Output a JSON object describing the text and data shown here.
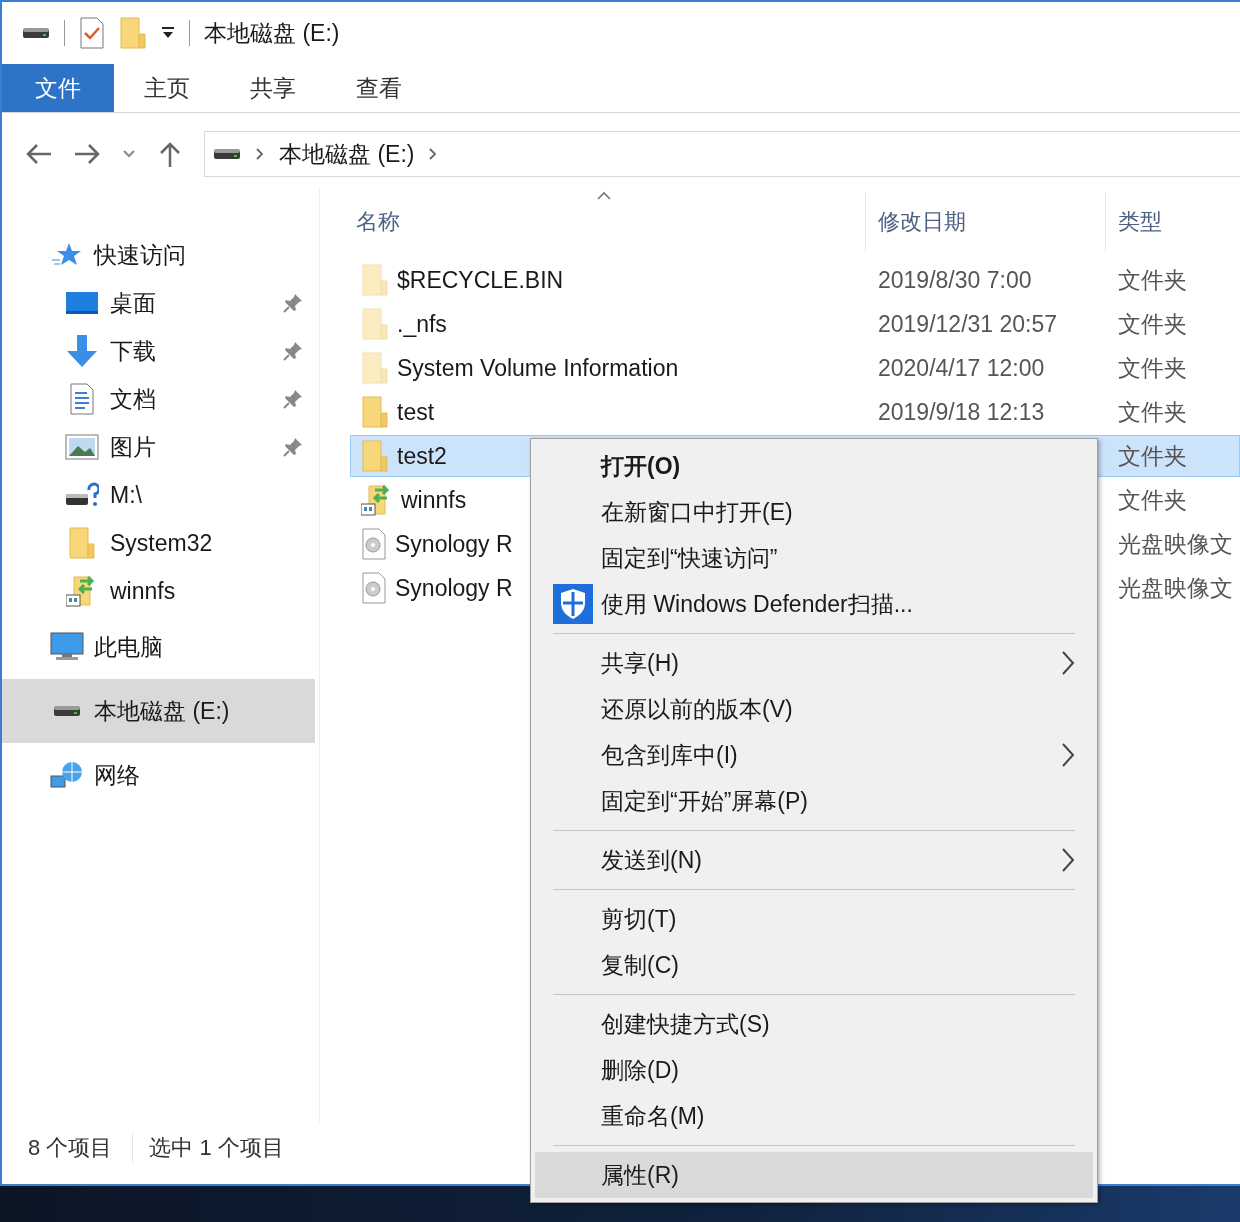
{
  "window": {
    "title": "本地磁盘 (E:)"
  },
  "ribbon_tabs": [
    {
      "label": "文件",
      "selected": true
    },
    {
      "label": "主页",
      "selected": false
    },
    {
      "label": "共享",
      "selected": false
    },
    {
      "label": "查看",
      "selected": false
    }
  ],
  "address_bar": {
    "path": "本地磁盘 (E:)"
  },
  "sidebar": {
    "items": [
      {
        "label": "快速访问",
        "selected": false,
        "children": [
          {
            "label": "桌面",
            "pinned": true,
            "selected": false
          },
          {
            "label": "下载",
            "pinned": true,
            "selected": false
          },
          {
            "label": "文档",
            "pinned": true,
            "selected": false
          },
          {
            "label": "图片",
            "pinned": true,
            "selected": false
          },
          {
            "label": "M:\\",
            "pinned": false,
            "selected": false
          },
          {
            "label": "System32",
            "pinned": false,
            "selected": false
          },
          {
            "label": "winnfs",
            "pinned": false,
            "selected": false
          }
        ]
      },
      {
        "label": "此电脑",
        "selected": false
      },
      {
        "label": "本地磁盘 (E:)",
        "selected": true
      },
      {
        "label": "网络",
        "selected": false
      }
    ]
  },
  "table": {
    "columns": [
      {
        "label": "名称",
        "sorted": true
      },
      {
        "label": "修改日期",
        "sorted": false
      },
      {
        "label": "类型",
        "sorted": false
      }
    ],
    "rows": [
      {
        "kind": "folder",
        "name": "$RECYCLE.BIN",
        "date": "2019/8/30 7:00",
        "type": "文件夹",
        "hidden": true,
        "selected": false
      },
      {
        "kind": "folder",
        "name": "._nfs",
        "date": "2019/12/31 20:57",
        "type": "文件夹",
        "hidden": true,
        "selected": false
      },
      {
        "kind": "folder",
        "name": "System Volume Information",
        "date": "2020/4/17 12:00",
        "type": "文件夹",
        "hidden": true,
        "selected": false
      },
      {
        "kind": "folder",
        "name": "test",
        "date": "2019/9/18 12:13",
        "type": "文件夹",
        "hidden": false,
        "selected": false
      },
      {
        "kind": "folder",
        "name": "test2",
        "type": "文件夹",
        "hidden": false,
        "selected": true
      },
      {
        "kind": "shared",
        "name": "winnfs",
        "type": "文件夹",
        "hidden": false,
        "selected": false
      },
      {
        "kind": "disc",
        "name": "Synology R",
        "type": "光盘映像文",
        "hidden": false,
        "selected": false
      },
      {
        "kind": "disc",
        "name": "Synology R",
        "type": "光盘映像文",
        "hidden": false,
        "selected": false
      }
    ]
  },
  "status_bar": {
    "item_count": "8 个项目",
    "selection": "选中 1 个项目"
  },
  "context_menu": {
    "groups": [
      [
        {
          "label": "打开(O)",
          "default": true,
          "submenu": false,
          "shield": false,
          "selected": false
        },
        {
          "label": "在新窗口中打开(E)",
          "default": false,
          "submenu": false,
          "shield": false,
          "selected": false
        },
        {
          "label": "固定到“快速访问”",
          "default": false,
          "submenu": false,
          "shield": false,
          "selected": false
        },
        {
          "label": "使用 Windows Defender扫描...",
          "default": false,
          "submenu": false,
          "shield": true,
          "selected": false
        }
      ],
      [
        {
          "label": "共享(H)",
          "default": false,
          "submenu": true,
          "shield": false,
          "selected": false
        },
        {
          "label": "还原以前的版本(V)",
          "default": false,
          "submenu": false,
          "shield": false,
          "selected": false
        },
        {
          "label": "包含到库中(I)",
          "default": false,
          "submenu": true,
          "shield": false,
          "selected": false
        },
        {
          "label": "固定到“开始”屏幕(P)",
          "default": false,
          "submenu": false,
          "shield": false,
          "selected": false
        }
      ],
      [
        {
          "label": "发送到(N)",
          "default": false,
          "submenu": true,
          "shield": false,
          "selected": false
        }
      ],
      [
        {
          "label": "剪切(T)",
          "default": false,
          "submenu": false,
          "shield": false,
          "selected": false
        },
        {
          "label": "复制(C)",
          "default": false,
          "submenu": false,
          "shield": false,
          "selected": false
        }
      ],
      [
        {
          "label": "创建快捷方式(S)",
          "default": false,
          "submenu": false,
          "shield": false,
          "selected": false
        },
        {
          "label": "删除(D)",
          "default": false,
          "submenu": false,
          "shield": false,
          "selected": false
        },
        {
          "label": "重命名(M)",
          "default": false,
          "submenu": false,
          "shield": false,
          "selected": false
        }
      ],
      [
        {
          "label": "属性(R)",
          "default": false,
          "submenu": false,
          "shield": false,
          "selected": true
        }
      ]
    ]
  }
}
